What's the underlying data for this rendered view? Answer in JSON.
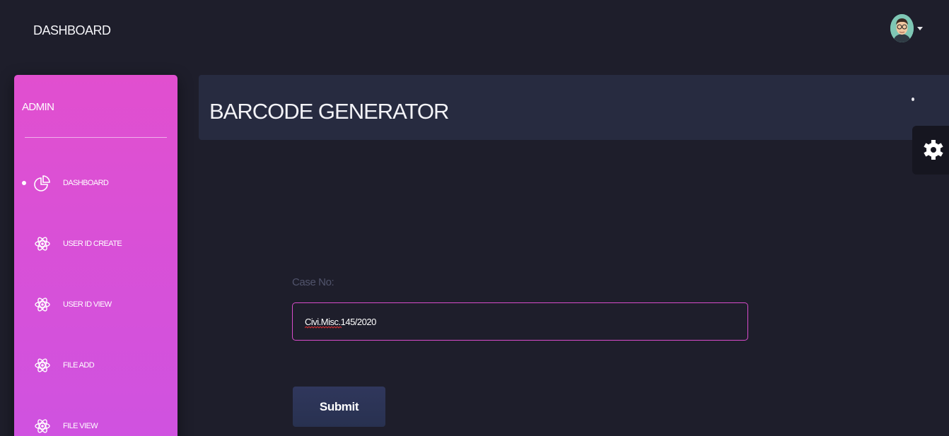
{
  "topbar": {
    "brand": "DASHBOARD"
  },
  "sidebar": {
    "title": "ADMIN",
    "items": [
      {
        "label": "DASHBOARD",
        "icon": "pie-chart-icon",
        "active": true
      },
      {
        "label": "USER ID CREATE",
        "icon": "atom-icon"
      },
      {
        "label": "USER ID VIEW",
        "icon": "atom-icon"
      },
      {
        "label": "FILE ADD",
        "icon": "atom-icon"
      },
      {
        "label": "FILE VIEW",
        "icon": "atom-icon"
      }
    ]
  },
  "main": {
    "title": "BARCODE GENERATOR",
    "form": {
      "case_label": "Case No:",
      "case_value": "Civi.Misc.145/2020",
      "submit_label": "Submit"
    }
  },
  "colors": {
    "background": "#1e1e2b",
    "sidebar_gradient_top": "#e14fcf",
    "sidebar_gradient_bottom": "#cf52e0",
    "header_card": "#272b40",
    "input_border": "#d94ccb",
    "button": "#2d355a"
  },
  "icons": {
    "settings": "gear-icon",
    "user": "avatar",
    "menu": "chevron-down-icon"
  }
}
